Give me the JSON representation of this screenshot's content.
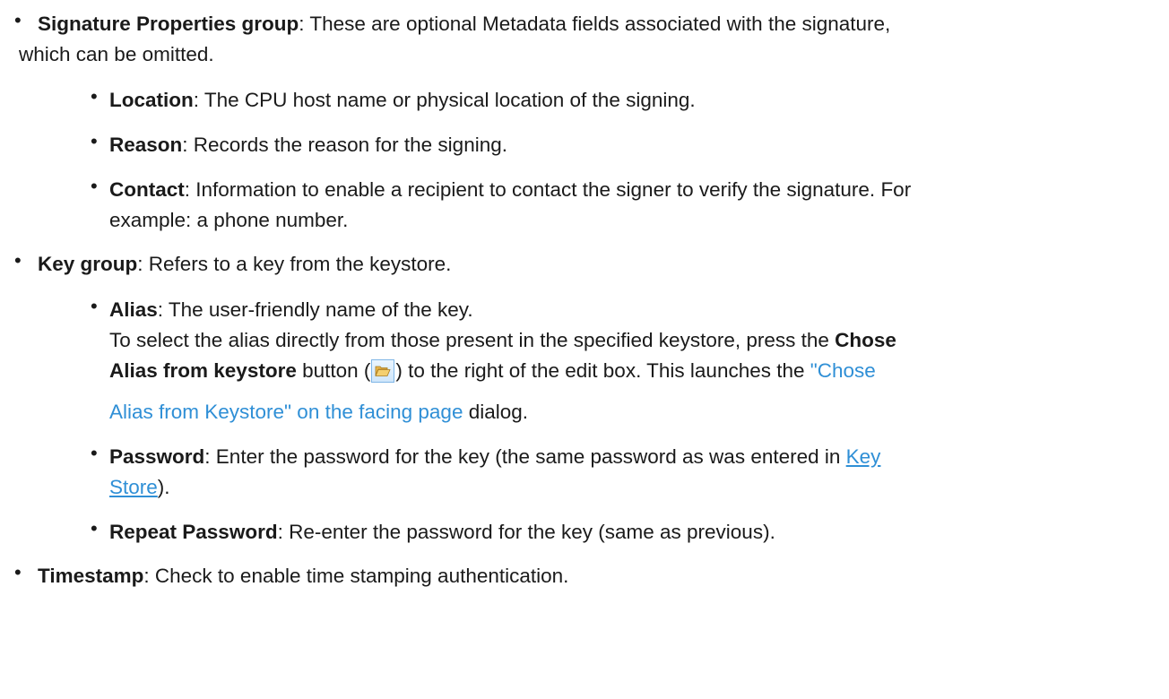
{
  "sig_group": {
    "term": "Signature Properties group",
    "desc": ": These are optional Metadata fields associated with the signature,",
    "desc2": "which can be omitted.",
    "items": [
      {
        "term": "Location",
        "desc": ": The CPU host name or physical location of the signing."
      },
      {
        "term": "Reason",
        "desc": ": Records the reason for the signing."
      },
      {
        "term": "Contact",
        "desc": ": Information to enable a recipient to contact the signer to verify the signature. For",
        "desc2": "example: a phone number."
      }
    ]
  },
  "key_group": {
    "term": "Key group",
    "desc": ": Refers to a key from the keystore.",
    "alias": {
      "term": "Alias",
      "desc": ": The user-friendly name of the key.",
      "line2": "To select the alias directly from those present in the specified keystore, press the ",
      "btn_term1": "Chose",
      "btn_term2": "Alias from keystore",
      "line3_a": " button (",
      "line3_b": ") to the right of the edit box. This launches the ",
      "link1": "\"Chose",
      "link2": "Alias from Keystore\" on the facing page",
      "line4_end": " dialog."
    },
    "password": {
      "term": "Password",
      "desc": ": Enter the password for the key (the same password as was entered in ",
      "link_a": "Key",
      "link_b": "Store",
      "end": ")."
    },
    "repeat": {
      "term": "Repeat Password",
      "desc": ": Re-enter the password for the key (same as previous)."
    }
  },
  "timestamp": {
    "term": "Timestamp",
    "desc": ": Check to enable time stamping authentication."
  },
  "icons": {
    "folder": "open-folder-icon"
  },
  "colors": {
    "link": "#2f8fd6",
    "text": "#1a1a1a"
  }
}
